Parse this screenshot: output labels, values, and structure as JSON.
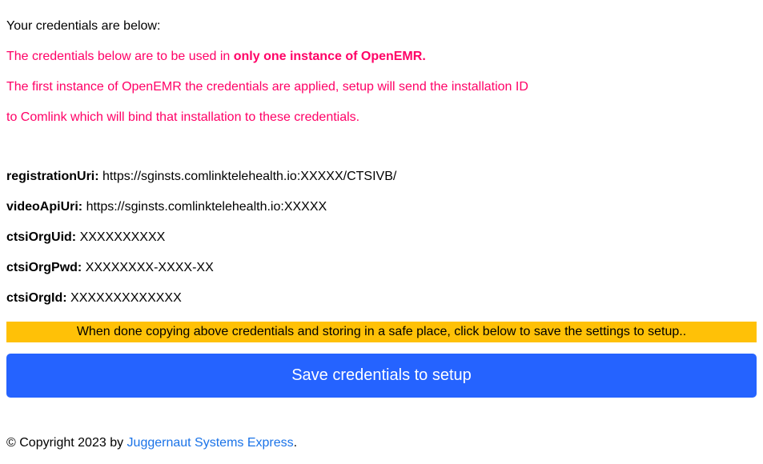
{
  "header": {
    "intro": "Your credentials are below:",
    "warning1_prefix": "The credentials below are to be used in ",
    "warning1_bold": "only one instance of OpenEMR.",
    "warning2": "The first instance of OpenEMR the credentials are applied, setup will send the installation ID",
    "warning3": "to Comlink which will bind that installation to these credentials."
  },
  "credentials": {
    "registrationUri": {
      "label": "registrationUri:",
      "value": "https://sginsts.comlinktelehealth.io:XXXXX/CTSIVB/"
    },
    "videoApiUri": {
      "label": "videoApiUri:",
      "value": "https://sginsts.comlinktelehealth.io:XXXXX"
    },
    "ctsiOrgUid": {
      "label": "ctsiOrgUid:",
      "value": "XXXXXXXXXX"
    },
    "ctsiOrgPwd": {
      "label": "ctsiOrgPwd:",
      "value": "XXXXXXXX-XXXX-XX"
    },
    "ctsiOrgId": {
      "label": "ctsiOrgId:",
      "value": "XXXXXXXXXXXXX"
    }
  },
  "banner": {
    "text": "When done copying above credentials and storing in a safe place, click below to save the settings to setup.."
  },
  "button": {
    "save_label": "Save credentials to setup"
  },
  "footer": {
    "copyright_prefix": "© Copyright 2023 by ",
    "link_text": "Juggernaut Systems Express",
    "suffix": "."
  }
}
